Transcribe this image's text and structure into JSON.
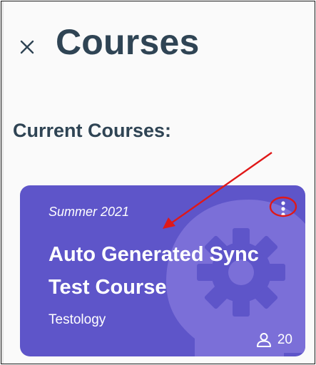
{
  "header": {
    "title": "Courses",
    "close_icon": "close-icon"
  },
  "section": {
    "title": "Current Courses:"
  },
  "course_card": {
    "term": "Summer 2021",
    "name": "Auto Generated Sync Test Course",
    "organization": "Testology",
    "member_count": "20",
    "background_color": "#5e55c9",
    "menu_icon": "more-vertical-icon",
    "members_icon": "person-icon",
    "art_icon": "head-gear-icon"
  },
  "annotation": {
    "color": "#e01818",
    "type": "arrow-and-circle"
  }
}
